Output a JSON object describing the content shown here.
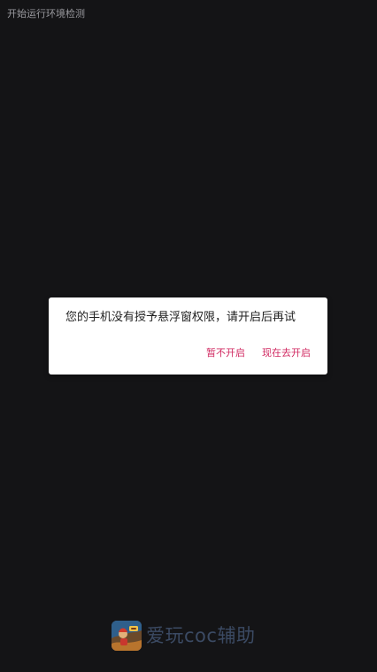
{
  "status": {
    "text": "开始运行环境检测"
  },
  "dialog": {
    "message": "您的手机没有授予悬浮窗权限，请开启后再试",
    "buttons": [
      {
        "label": "暂不开启"
      },
      {
        "label": "现在去开启"
      }
    ],
    "accent_color": "#d12a62"
  },
  "brand": {
    "icon": "game-app-icon",
    "text": "爱玩coc辅助"
  },
  "colors": {
    "background": "#141416",
    "dialog_bg": "#ffffff",
    "brand_text": "#3b4a63"
  }
}
